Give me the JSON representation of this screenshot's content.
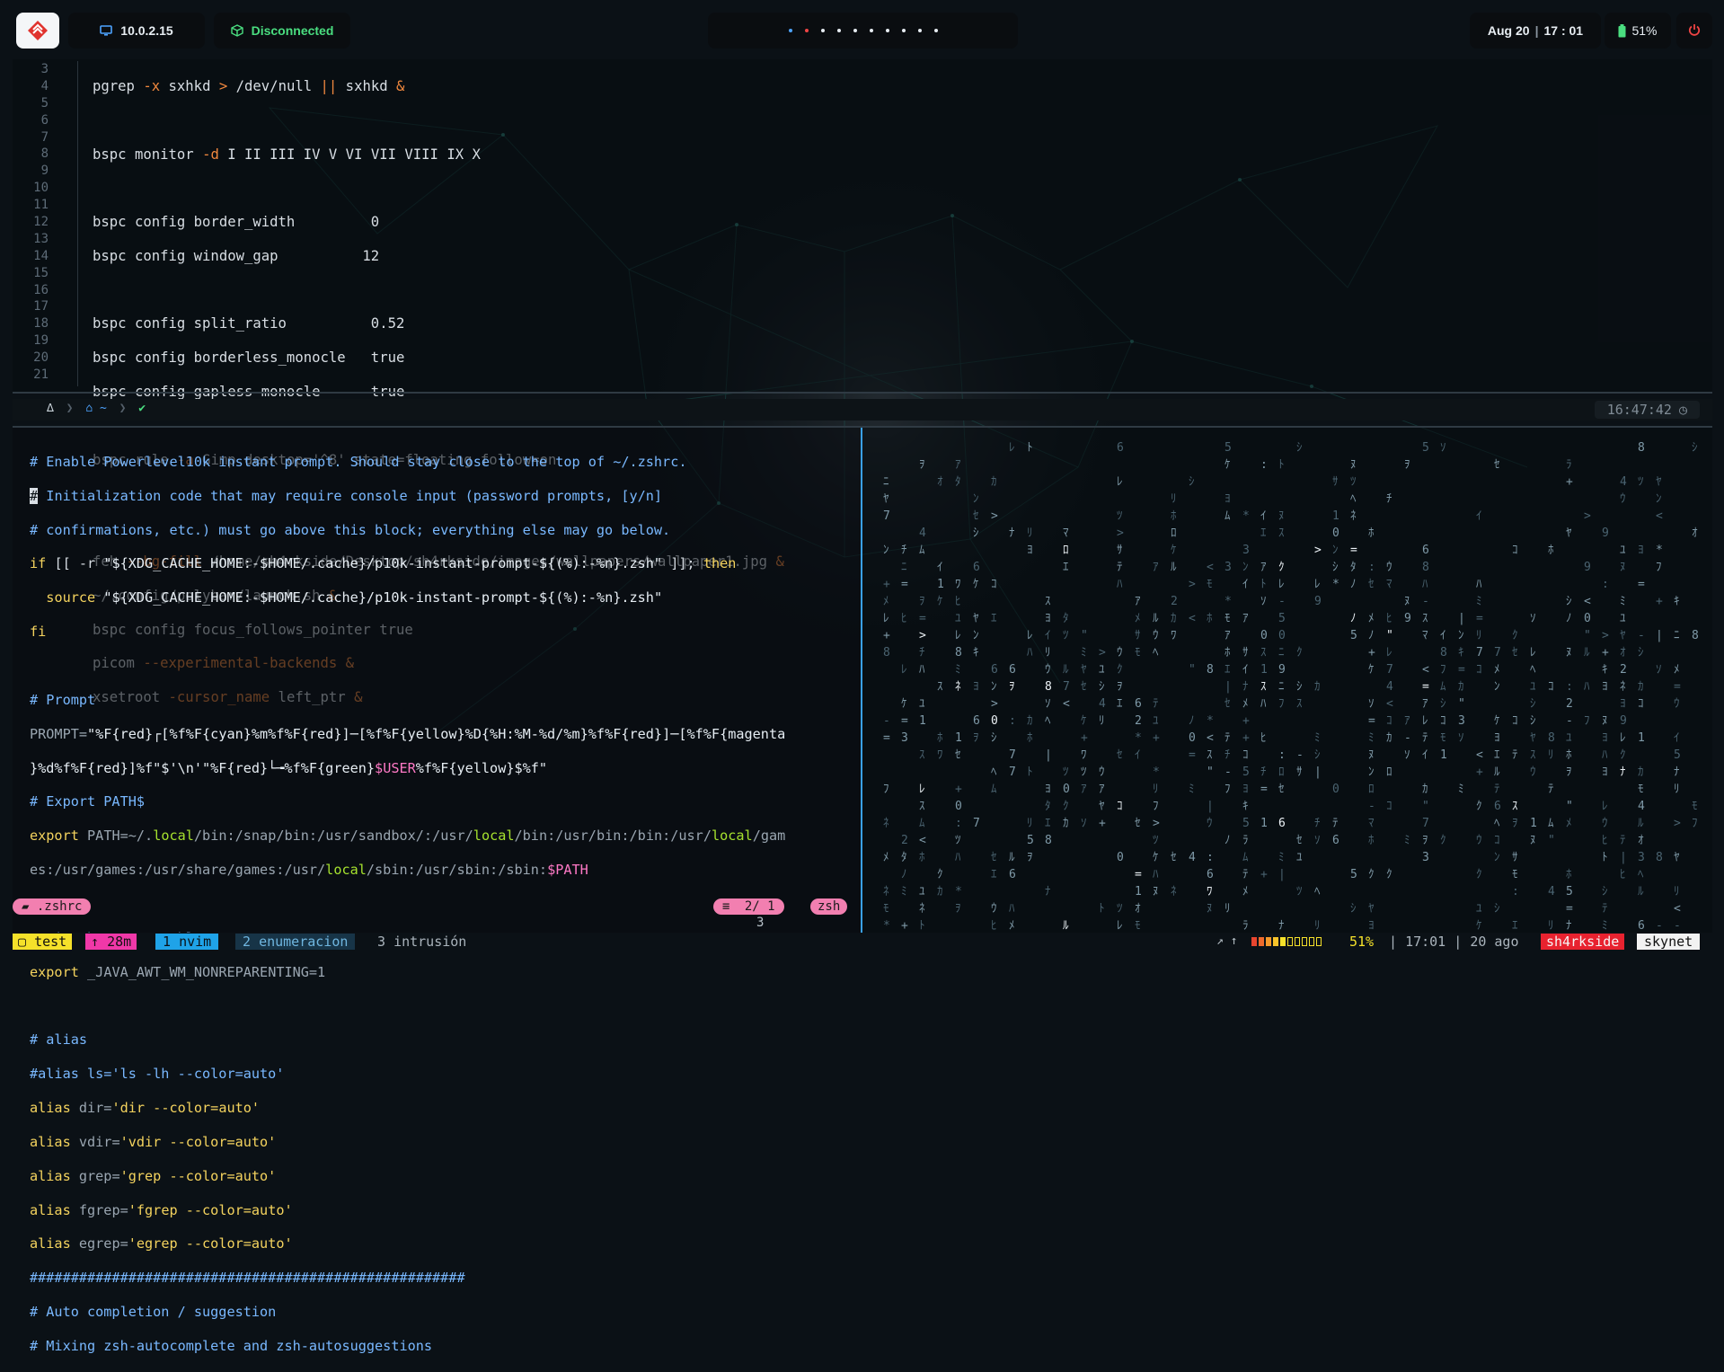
{
  "topbar": {
    "ip": "10.0.2.15",
    "vpn_status": "Disconnected",
    "workspace_dots": 10,
    "date": "Aug 20",
    "time": "17 : 01",
    "battery": "51%",
    "accent_blue": "#4da3ff",
    "accent_green": "#4ade80",
    "power_color": "#ef4444"
  },
  "editor_top": {
    "line_numbers": [
      "3",
      "4",
      "5",
      "6",
      "7",
      "8",
      "9",
      "10",
      "11",
      "12",
      "13",
      "14",
      "15",
      "16",
      "17",
      "18",
      "19",
      "20",
      "21"
    ]
  },
  "prompt_bar": {
    "status_check": "✔",
    "path": "~",
    "clock": "16:47:42"
  },
  "editor_bottom": {
    "filename": ".zshrc",
    "position": "2/ 1",
    "filetype": "zsh",
    "below_num": "3"
  },
  "tmux": {
    "session": "test",
    "uptime": "28m",
    "windows": [
      {
        "index": "1",
        "name": "nvim",
        "active": true
      },
      {
        "index": "2",
        "name": "enumeracion",
        "active": false
      },
      {
        "index": "3",
        "name": "intrusión",
        "active": false
      }
    ],
    "arrows": "↗ ↑",
    "battery_pct": "51%",
    "time": "17:01",
    "date": "20 ago",
    "user": "sh4rkside",
    "host": "skynet"
  }
}
